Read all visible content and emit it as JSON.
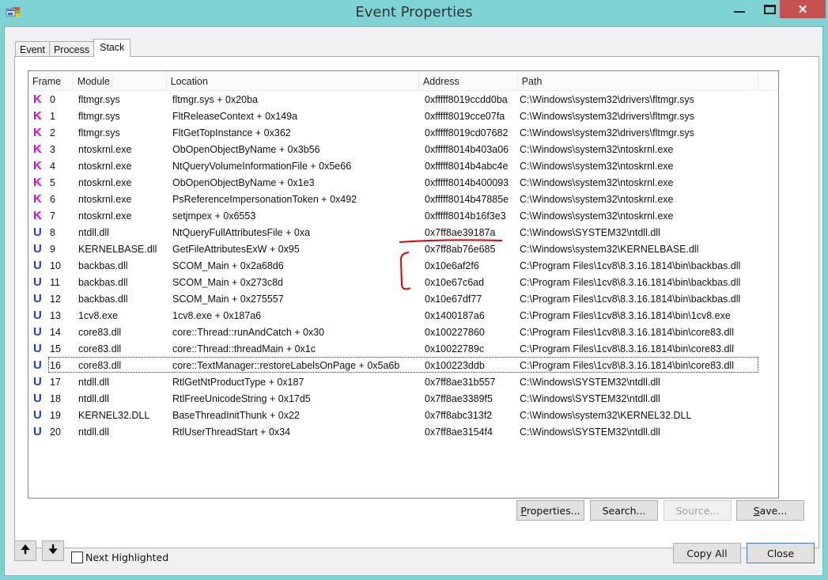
{
  "window": {
    "title": "Event Properties",
    "icon": "app-window-icon",
    "controls": {
      "minimize": "minimize",
      "maximize": "maximize",
      "close": "✕"
    }
  },
  "tabs": [
    {
      "label": "Event",
      "active": false
    },
    {
      "label": "Process",
      "active": false
    },
    {
      "label": "Stack",
      "active": true
    }
  ],
  "stack": {
    "columns": [
      "Frame",
      "Module",
      "Location",
      "Address",
      "Path"
    ],
    "focused_frame": 16,
    "rows": [
      {
        "kind": "K",
        "frame": "0",
        "module": "fltmgr.sys",
        "location": "fltmgr.sys + 0x20ba",
        "address": "0xfffff8019ccdd0ba",
        "path": "C:\\Windows\\system32\\drivers\\fltmgr.sys"
      },
      {
        "kind": "K",
        "frame": "1",
        "module": "fltmgr.sys",
        "location": "FltReleaseContext + 0x149a",
        "address": "0xfffff8019cce07fa",
        "path": "C:\\Windows\\system32\\drivers\\fltmgr.sys"
      },
      {
        "kind": "K",
        "frame": "2",
        "module": "fltmgr.sys",
        "location": "FltGetTopInstance + 0x362",
        "address": "0xfffff8019cd07682",
        "path": "C:\\Windows\\system32\\drivers\\fltmgr.sys"
      },
      {
        "kind": "K",
        "frame": "3",
        "module": "ntoskrnl.exe",
        "location": "ObOpenObjectByName + 0x3b56",
        "address": "0xfffff8014b403a06",
        "path": "C:\\Windows\\system32\\ntoskrnl.exe"
      },
      {
        "kind": "K",
        "frame": "4",
        "module": "ntoskrnl.exe",
        "location": "NtQueryVolumeInformationFile + 0x5e66",
        "address": "0xfffff8014b4abc4e",
        "path": "C:\\Windows\\system32\\ntoskrnl.exe"
      },
      {
        "kind": "K",
        "frame": "5",
        "module": "ntoskrnl.exe",
        "location": "ObOpenObjectByName + 0x1e3",
        "address": "0xfffff8014b400093",
        "path": "C:\\Windows\\system32\\ntoskrnl.exe"
      },
      {
        "kind": "K",
        "frame": "6",
        "module": "ntoskrnl.exe",
        "location": "PsReferenceImpersonationToken + 0x492",
        "address": "0xfffff8014b47885e",
        "path": "C:\\Windows\\system32\\ntoskrnl.exe"
      },
      {
        "kind": "K",
        "frame": "7",
        "module": "ntoskrnl.exe",
        "location": "setjmpex + 0x6553",
        "address": "0xfffff8014b16f3e3",
        "path": "C:\\Windows\\system32\\ntoskrnl.exe"
      },
      {
        "kind": "U",
        "frame": "8",
        "module": "ntdll.dll",
        "location": "NtQueryFullAttributesFile + 0xa",
        "address": "0x7ff8ae39187a",
        "path": "C:\\Windows\\SYSTEM32\\ntdll.dll"
      },
      {
        "kind": "U",
        "frame": "9",
        "module": "KERNELBASE.dll",
        "location": "GetFileAttributesExW + 0x95",
        "address": "0x7ff8ab76e685",
        "path": "C:\\Windows\\system32\\KERNELBASE.dll"
      },
      {
        "kind": "U",
        "frame": "10",
        "module": "backbas.dll",
        "location": "SCOM_Main + 0x2a68d6",
        "address": "0x10e6af2f6",
        "path": "C:\\Program Files\\1cv8\\8.3.16.1814\\bin\\backbas.dll"
      },
      {
        "kind": "U",
        "frame": "11",
        "module": "backbas.dll",
        "location": "SCOM_Main + 0x273c8d",
        "address": "0x10e67c6ad",
        "path": "C:\\Program Files\\1cv8\\8.3.16.1814\\bin\\backbas.dll"
      },
      {
        "kind": "U",
        "frame": "12",
        "module": "backbas.dll",
        "location": "SCOM_Main + 0x275557",
        "address": "0x10e67df77",
        "path": "C:\\Program Files\\1cv8\\8.3.16.1814\\bin\\backbas.dll"
      },
      {
        "kind": "U",
        "frame": "13",
        "module": "1cv8.exe",
        "location": "1cv8.exe + 0x187a6",
        "address": "0x1400187a6",
        "path": "C:\\Program Files\\1cv8\\8.3.16.1814\\bin\\1cv8.exe"
      },
      {
        "kind": "U",
        "frame": "14",
        "module": "core83.dll",
        "location": "core::Thread::runAndCatch + 0x30",
        "address": "0x100227860",
        "path": "C:\\Program Files\\1cv8\\8.3.16.1814\\bin\\core83.dll"
      },
      {
        "kind": "U",
        "frame": "15",
        "module": "core83.dll",
        "location": "core::Thread::threadMain + 0x1c",
        "address": "0x10022789c",
        "path": "C:\\Program Files\\1cv8\\8.3.16.1814\\bin\\core83.dll"
      },
      {
        "kind": "U",
        "frame": "16",
        "module": "core83.dll",
        "location": "core::TextManager::restoreLabelsOnPage + 0x5a6b",
        "address": "0x100223ddb",
        "path": "C:\\Program Files\\1cv8\\8.3.16.1814\\bin\\core83.dll"
      },
      {
        "kind": "U",
        "frame": "17",
        "module": "ntdll.dll",
        "location": "RtlGetNtProductType + 0x187",
        "address": "0x7ff8ae31b557",
        "path": "C:\\Windows\\SYSTEM32\\ntdll.dll"
      },
      {
        "kind": "U",
        "frame": "18",
        "module": "ntdll.dll",
        "location": "RtlFreeUnicodeString + 0x17d5",
        "address": "0x7ff8ae3389f5",
        "path": "C:\\Windows\\SYSTEM32\\ntdll.dll"
      },
      {
        "kind": "U",
        "frame": "19",
        "module": "KERNEL32.DLL",
        "location": "BaseThreadInitThunk + 0x22",
        "address": "0x7ff8abc313f2",
        "path": "C:\\Windows\\system32\\KERNEL32.DLL"
      },
      {
        "kind": "U",
        "frame": "20",
        "module": "ntdll.dll",
        "location": "RtlUserThreadStart + 0x34",
        "address": "0x7ff8ae3154f4",
        "path": "C:\\Windows\\SYSTEM32\\ntdll.dll"
      }
    ]
  },
  "panel_buttons": {
    "properties": {
      "pre": "",
      "key": "P",
      "post": "roperties..."
    },
    "search": "Search...",
    "source": "Source...",
    "save": {
      "pre": "",
      "key": "S",
      "post": "ave..."
    }
  },
  "footer": {
    "up_icon": "🠉",
    "down_icon": "🠋",
    "next_highlighted_label": "Next Highlighted",
    "next_highlighted_checked": false,
    "copy_all": "Copy All",
    "close": "Close"
  },
  "colors": {
    "kernel_frame": "#e600e6",
    "user_frame": "#1f3fc8",
    "annotation": "#e00000",
    "titlebar": "#7dd3d3",
    "close_button": "#c75050"
  }
}
